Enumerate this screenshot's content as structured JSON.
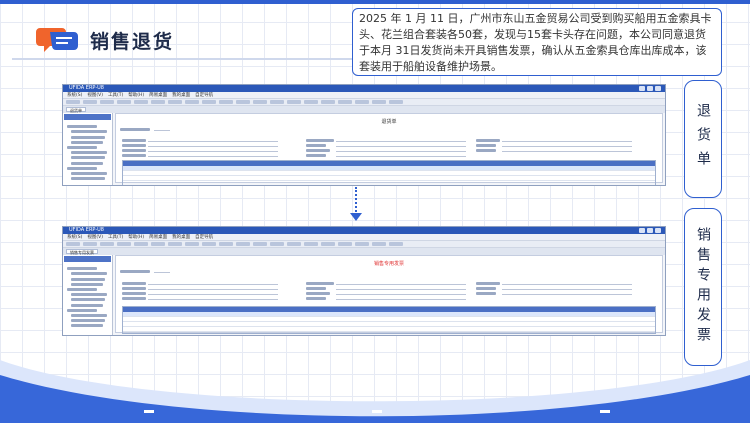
{
  "header": {
    "title": "销售退货",
    "description": "2025 年 1 月 11 日，广州市东山五金贸易公司受到购买船用五金索具卡头、花兰组合套装各50套，发现与15套卡头存在问题，本公司同意退货于本月 31日发货尚未开具销售发票，确认从五金索具仓库出库成本，该套装用于船舶设备维护场景。"
  },
  "screens": [
    {
      "window_title": "UFIDA ERP-U8",
      "menu": [
        "系统(S)",
        "视图(V)",
        "工具(T)",
        "帮助(H)",
        "简易桌面",
        "我的桌面",
        "自定导航"
      ],
      "tab": "退货单",
      "form_title": "退货单",
      "callout": "退货单"
    },
    {
      "window_title": "UFIDA ERP-U8",
      "menu": [
        "系统(S)",
        "视图(V)",
        "工具(T)",
        "帮助(H)",
        "简易桌面",
        "我的桌面",
        "自定导航"
      ],
      "tab": "销售专用发票",
      "form_title": "销售专用发票",
      "callout": "销售专用发票"
    }
  ],
  "colors": {
    "accent": "#2f5fd0",
    "logo_orange": "#f0642c",
    "invoice_title": "#e03030"
  },
  "icons": [
    "chat-logo-icon",
    "arrow-down-icon"
  ]
}
